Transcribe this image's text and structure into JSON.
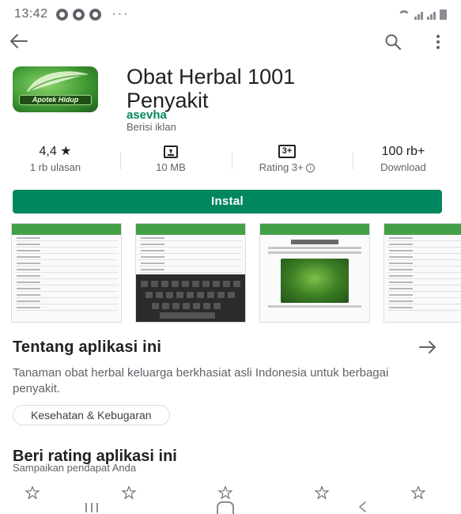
{
  "status_bar": {
    "time": "13:42",
    "more": "···"
  },
  "app": {
    "title_line1": "Obat Herbal 1001",
    "title_line2": "Penyakit",
    "developer": "asevha",
    "ads_note": "Berisi iklan",
    "logo_text": "Apotek Hidup"
  },
  "stats": {
    "rating_value": "4,4",
    "rating_star": "★",
    "reviews": "1 rb ulasan",
    "size": "10 MB",
    "content_rating_badge": "3+",
    "content_rating_label": "Rating 3+",
    "info_glyph": "i",
    "downloads_value": "100 rb+",
    "downloads_label": "Download"
  },
  "install_label": "Instal",
  "about": {
    "title": "Tentang aplikasi ini",
    "description": "Tanaman obat herbal keluarga berkhasiat asli Indonesia untuk berbagai penyakit.",
    "category_chip": "Kesehatan & Kebugaran"
  },
  "rate": {
    "title": "Beri rating aplikasi ini",
    "subtitle": "Sampaikan pendapat Anda",
    "stars": 5
  },
  "colors": {
    "brand_green": "#01875f",
    "screenshot_bar": "#43a047"
  },
  "icons": [
    "back-arrow-icon",
    "search-icon",
    "more-vert-icon",
    "download-size-icon",
    "info-icon",
    "arrow-right-icon",
    "star-outline-icon",
    "nav-recents-icon",
    "nav-home-icon",
    "nav-back-icon"
  ]
}
